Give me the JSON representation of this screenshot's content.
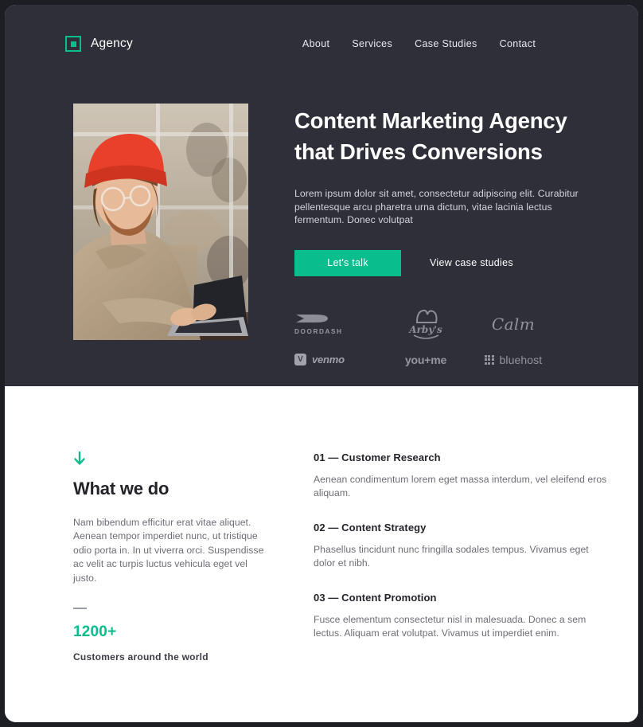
{
  "brand": {
    "name": "Agency",
    "logo_icon": "square-in-square-icon",
    "accent_color": "#09bd8d"
  },
  "nav": {
    "items": [
      {
        "label": "About"
      },
      {
        "label": "Services"
      },
      {
        "label": "Case Studies"
      },
      {
        "label": "Contact"
      }
    ]
  },
  "hero": {
    "background_color": "#2f2f3a",
    "title_line1": "Content Marketing Agency",
    "title_line2": "that Drives Conversions",
    "subtitle": "Lorem ipsum dolor sit amet, consectetur adipiscing elit. Curabitur pellentesque arcu pharetra urna dictum, vitae lacinia lectus fermentum. Donec volutpat",
    "primary_cta": "Let's talk",
    "secondary_cta": "View case studies",
    "photo_alt": "man-in-red-beanie-working-on-laptop"
  },
  "clients": {
    "logos": [
      {
        "name": "DoorDash",
        "wordmark": "DOORDASH",
        "icon": "doordash-chevron-icon"
      },
      {
        "name": "Arby's",
        "wordmark": "Arby's",
        "icon": "arbys-hat-icon"
      },
      {
        "name": "Calm",
        "wordmark": "Calm",
        "icon": "calm-script-icon"
      },
      {
        "name": "Venmo",
        "wordmark": "venmo",
        "icon": "venmo-v-badge-icon"
      },
      {
        "name": "you+me",
        "wordmark": "you+me",
        "icon": "youme-wordmark-icon"
      },
      {
        "name": "bluehost",
        "wordmark": "bluehost",
        "icon": "bluehost-dot-grid-icon"
      }
    ]
  },
  "what_we_do": {
    "arrow_icon": "arrow-down-icon",
    "title": "What we do",
    "copy": "Nam bibendum efficitur erat vitae aliquet. Aenean tempor imperdiet nunc, ut tristique odio porta in. In ut viverra orci. Suspendisse ac velit ac turpis luctus vehicula eget vel justo.",
    "stat_value": "1200+",
    "stat_label": "Customers around the world"
  },
  "services": {
    "items": [
      {
        "title": "01 — Customer Research",
        "desc": "Aenean condimentum lorem eget massa interdum, vel eleifend eros aliquam."
      },
      {
        "title": "02 — Content Strategy",
        "desc": "Phasellus tincidunt nunc fringilla sodales tempus. Vivamus eget dolor et nibh."
      },
      {
        "title": "03 — Content Promotion",
        "desc": "Fusce elementum consectetur nisl in malesuada. Donec a sem lectus. Aliquam erat volutpat. Vivamus ut imperdiet enim."
      }
    ]
  }
}
